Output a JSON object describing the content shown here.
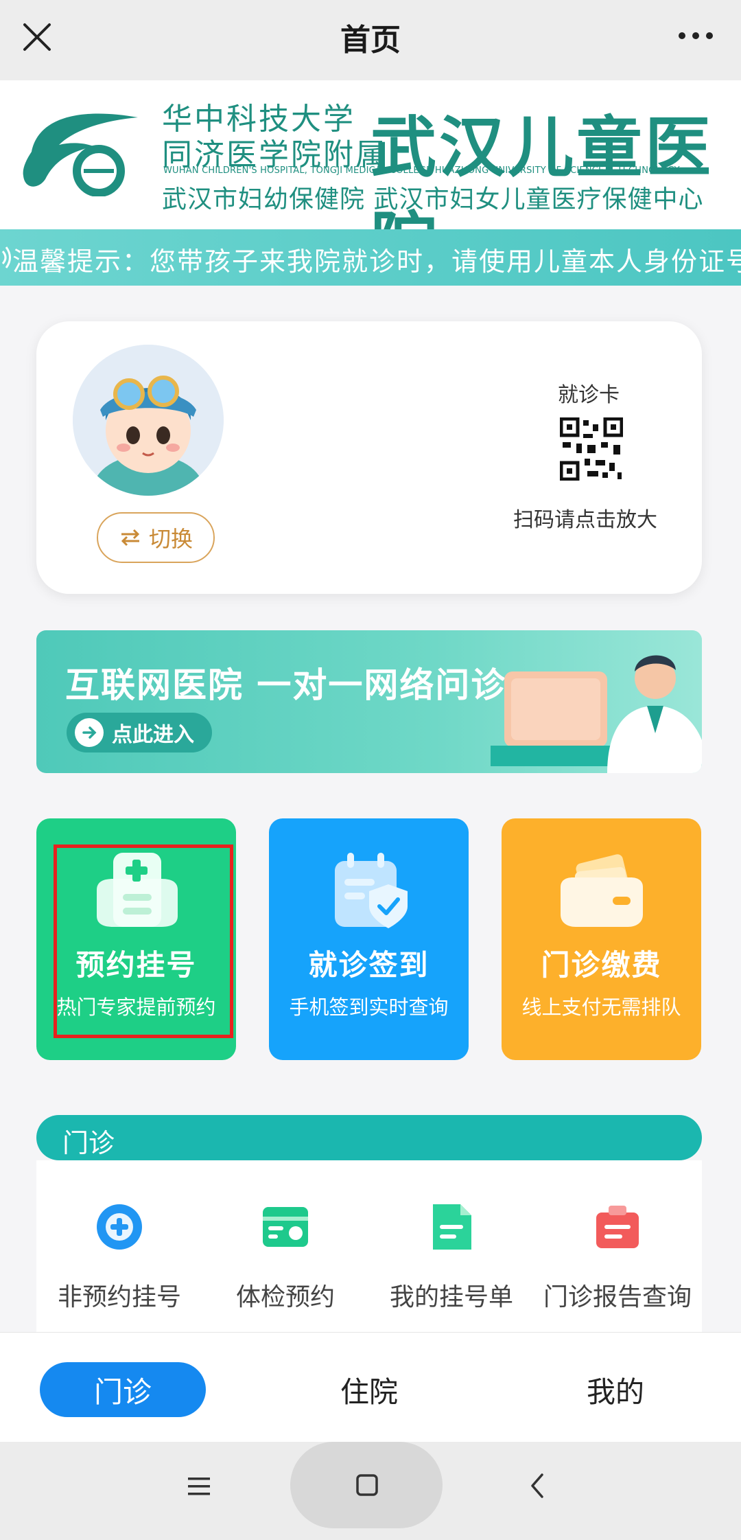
{
  "topbar": {
    "title": "首页",
    "close_icon": "close-icon",
    "more_icon": "more-icon"
  },
  "hospital": {
    "line1": "华中科技大学",
    "line2": "同济医学院附属",
    "name": "武汉儿童医院",
    "english": "WUHAN CHILDREN'S HOSPITAL, TONGJI MEDICAL COLLEGE HUAZHONG UNIVERSITY OF SCIENCE & TECHNOLOGY",
    "line3": "武汉市妇幼保健院  武汉市妇女儿童医疗保健中心",
    "brand_color": "#1f8f80"
  },
  "notice": {
    "text": "温馨提示：您带孩子来我院就诊时，请使用儿童本人身份证号"
  },
  "patient_card": {
    "switch_label": "切换",
    "card_label": "就诊卡",
    "scan_tip": "扫码请点击放大"
  },
  "banner": {
    "title": "互联网医院 一对一网络问诊",
    "enter_label": "点此进入"
  },
  "tiles": [
    {
      "name": "预约挂号",
      "sub": "热门专家提前预约",
      "color": "#1ecf86",
      "icon": "registration-icon"
    },
    {
      "name": "就诊签到",
      "sub": "手机签到实时查询",
      "color": "#16a3fb",
      "icon": "checkin-icon"
    },
    {
      "name": "门诊缴费",
      "sub": "线上支付无需排队",
      "color": "#fdb02b",
      "icon": "wallet-icon"
    }
  ],
  "outpatient": {
    "section_title": "门诊",
    "services": [
      {
        "label": "非预约挂号",
        "icon": "plus-circle-icon",
        "color": "#2196f3"
      },
      {
        "label": "体检预约",
        "icon": "id-card-icon",
        "color": "#1ec98c"
      },
      {
        "label": "我的挂号单",
        "icon": "document-icon",
        "color": "#2bd39a"
      },
      {
        "label": "门诊报告查询",
        "icon": "report-icon",
        "color": "#f25b5b"
      }
    ]
  },
  "tabbar": {
    "tabs": [
      "门诊",
      "住院",
      "我的"
    ],
    "active": "门诊",
    "active_color": "#1589f0"
  },
  "system_nav": {
    "menu_icon": "menu-icon",
    "home_icon": "home-icon",
    "back_icon": "back-icon"
  }
}
